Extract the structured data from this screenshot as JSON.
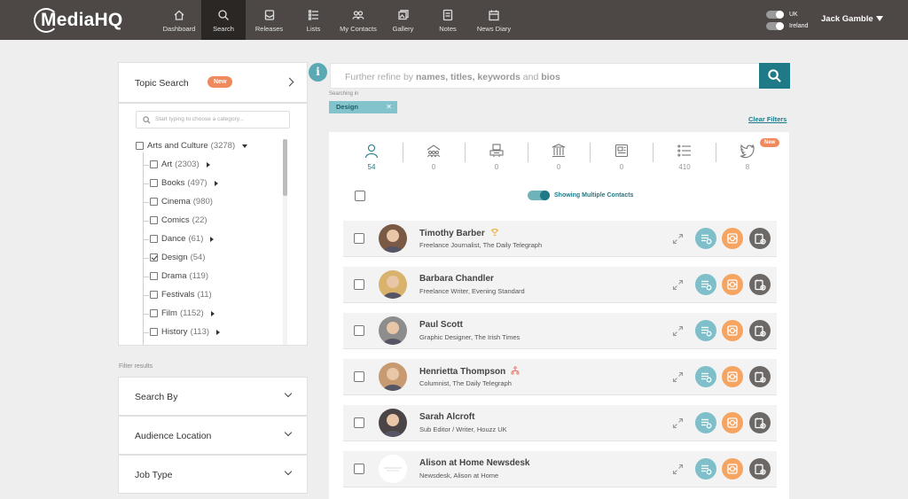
{
  "brand": {
    "logo_text": "MediaHQ"
  },
  "nav": [
    {
      "label": "Dashboard",
      "icon": "home-icon",
      "active": false
    },
    {
      "label": "Search",
      "icon": "search-icon",
      "active": true
    },
    {
      "label": "Releases",
      "icon": "releases-icon",
      "active": false
    },
    {
      "label": "Lists",
      "icon": "list-icon",
      "active": false
    },
    {
      "label": "My Contacts",
      "icon": "contacts-icon",
      "active": false
    },
    {
      "label": "Gallery",
      "icon": "gallery-icon",
      "active": false
    },
    {
      "label": "Notes",
      "icon": "notes-icon",
      "active": false
    },
    {
      "label": "News Diary",
      "icon": "calendar-icon",
      "active": false
    }
  ],
  "region": {
    "uk": "UK",
    "ireland": "Ireland"
  },
  "user": {
    "name": "Jack Gamble"
  },
  "topic_search": {
    "title": "Topic Search",
    "badge": "New",
    "placeholder": "Start typing to choose a category...",
    "categories": [
      {
        "label": "Arts and Culture",
        "count": "(3278)",
        "checked": false,
        "expanded": true,
        "level": 0
      },
      {
        "label": "Art",
        "count": "(2303)",
        "checked": false,
        "has_children": true,
        "level": 1
      },
      {
        "label": "Books",
        "count": "(497)",
        "checked": false,
        "has_children": true,
        "level": 1
      },
      {
        "label": "Cinema",
        "count": "(980)",
        "checked": false,
        "has_children": false,
        "level": 1
      },
      {
        "label": "Comics",
        "count": "(22)",
        "checked": false,
        "has_children": false,
        "level": 1
      },
      {
        "label": "Dance",
        "count": "(61)",
        "checked": false,
        "has_children": true,
        "level": 1
      },
      {
        "label": "Design",
        "count": "(54)",
        "checked": true,
        "has_children": false,
        "level": 1
      },
      {
        "label": "Drama",
        "count": "(119)",
        "checked": false,
        "has_children": false,
        "level": 1
      },
      {
        "label": "Festivals",
        "count": "(11)",
        "checked": false,
        "has_children": false,
        "level": 1
      },
      {
        "label": "Film",
        "count": "(1152)",
        "checked": false,
        "has_children": true,
        "level": 1
      },
      {
        "label": "History",
        "count": "(113)",
        "checked": false,
        "has_children": true,
        "level": 1
      }
    ]
  },
  "filters": {
    "label": "Filter results",
    "sections": [
      "Search By",
      "Audience Location",
      "Job Type"
    ]
  },
  "search": {
    "placeholder_parts": [
      "Further refine by ",
      "names, titles, keywords",
      " and ",
      "bios"
    ],
    "searching_in_label": "Searching in",
    "chip": "Design",
    "clear_filters": "Clear Filters"
  },
  "stats": [
    {
      "icon": "person-icon",
      "value": "54",
      "active": true
    },
    {
      "icon": "outlets-icon",
      "value": "0",
      "active": false
    },
    {
      "icon": "broadcast-icon",
      "value": "0",
      "active": false
    },
    {
      "icon": "institution-icon",
      "value": "0",
      "active": false
    },
    {
      "icon": "publication-icon",
      "value": "0",
      "active": false
    },
    {
      "icon": "list-icon",
      "value": "410",
      "active": false
    },
    {
      "icon": "twitter-icon",
      "value": "8",
      "active": false
    }
  ],
  "stats_new_badge": "New",
  "multi_toggle_label": "Showing Multiple Contacts",
  "contacts": [
    {
      "name": "Timothy Barber",
      "role": "Freelance Journalist, The Daily Telegraph",
      "badge": "trophy-icon",
      "avatar_bg": "#7a5a45"
    },
    {
      "name": "Barbara Chandler",
      "role": "Freelance Writer, Evening Standard",
      "badge": "",
      "avatar_bg": "#d9b26c"
    },
    {
      "name": "Paul Scott",
      "role": "Graphic Designer, The Irish Times",
      "badge": "",
      "avatar_bg": "#8d8d8d"
    },
    {
      "name": "Henrietta Thompson",
      "role": "Columnist, The Daily Telegraph",
      "badge": "network-icon",
      "avatar_bg": "#c79a72"
    },
    {
      "name": "Sarah Alcroft",
      "role": "Sub Editor / Writer, Houzz UK",
      "badge": "",
      "avatar_bg": "#4b4545"
    },
    {
      "name": "Alison at Home Newsdesk",
      "role": "Newsdesk, Alison at Home",
      "badge": "",
      "avatar_bg": "#ffffff"
    }
  ],
  "colors": {
    "accent": "#1e7a87",
    "badge": "#f08a5d",
    "action_blue": "#7fbfca",
    "action_orange": "#f5a461",
    "action_grey": "#6c6866",
    "topbar": "#4d4845"
  }
}
